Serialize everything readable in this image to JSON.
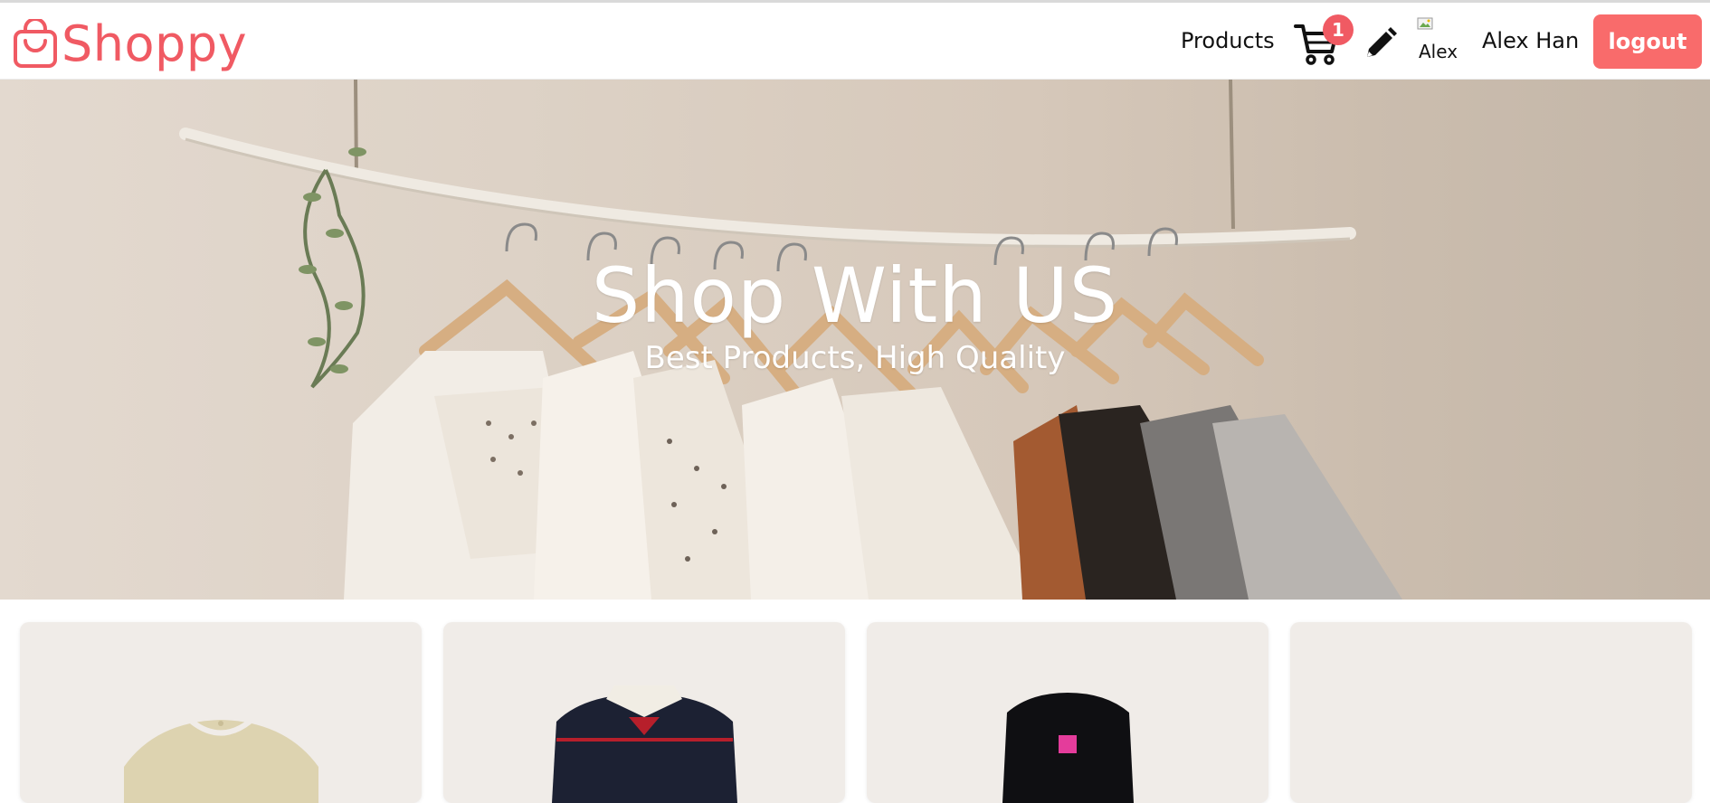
{
  "brand": {
    "name": "Shoppy",
    "color": "#f05a63",
    "icon": "shopping-bag-icon"
  },
  "nav": {
    "products_label": "Products",
    "cart_count": "1",
    "cart_icon": "cart-icon",
    "edit_icon": "pencil-icon",
    "avatar_alt": "Alex",
    "username": "Alex Han",
    "logout_label": "logout"
  },
  "hero": {
    "title": "Shop With US",
    "subtitle": "Best Products, High Quality"
  },
  "products": {
    "cards": [
      {
        "image": "beige-tweed-top"
      },
      {
        "image": "navy-striped-jacket"
      },
      {
        "image": "black-collar-top"
      },
      {
        "image": "empty"
      }
    ]
  },
  "colors": {
    "accent": "#f05a63",
    "logout_bg": "#f96b6b",
    "card_bg": "#f0ece8"
  }
}
